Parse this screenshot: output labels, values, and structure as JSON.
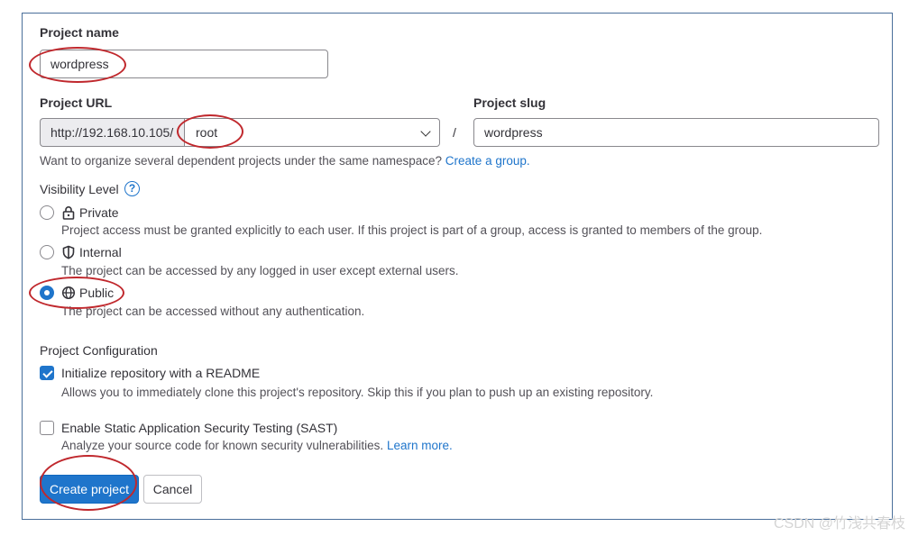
{
  "form": {
    "project_name_label": "Project name",
    "project_name_value": "wordpress",
    "project_url_label": "Project URL",
    "url_prefix": "http://192.168.10.105/",
    "namespace_value": "root",
    "slash": "/",
    "project_slug_label": "Project slug",
    "project_slug_value": "wordpress",
    "group_help_text": "Want to organize several dependent projects under the same namespace?",
    "group_help_link": "Create a group."
  },
  "visibility": {
    "label": "Visibility Level",
    "help_icon_glyph": "?",
    "options": [
      {
        "label": "Private",
        "description": "Project access must be granted explicitly to each user. If this project is part of a group, access is granted to members of the group.",
        "icon": "lock-icon",
        "checked": false
      },
      {
        "label": "Internal",
        "description": "The project can be accessed by any logged in user except external users.",
        "icon": "shield-icon",
        "checked": false
      },
      {
        "label": "Public",
        "description": "The project can be accessed without any authentication.",
        "icon": "globe-icon",
        "checked": true
      }
    ]
  },
  "configuration": {
    "heading": "Project Configuration",
    "readme_label": "Initialize repository with a README",
    "readme_description": "Allows you to immediately clone this project's repository. Skip this if you plan to push up an existing repository.",
    "readme_checked": true,
    "sast_label": "Enable Static Application Security Testing (SAST)",
    "sast_description": "Analyze your source code for known security vulnerabilities.",
    "sast_link": "Learn more.",
    "sast_checked": false
  },
  "buttons": {
    "create_label": "Create project",
    "cancel_label": "Cancel"
  },
  "watermark": "CSDN @竹浅共春枝",
  "colors": {
    "primary": "#1f75cb",
    "annotation_red": "#c0282d",
    "frame_border": "#4a6f9a"
  }
}
